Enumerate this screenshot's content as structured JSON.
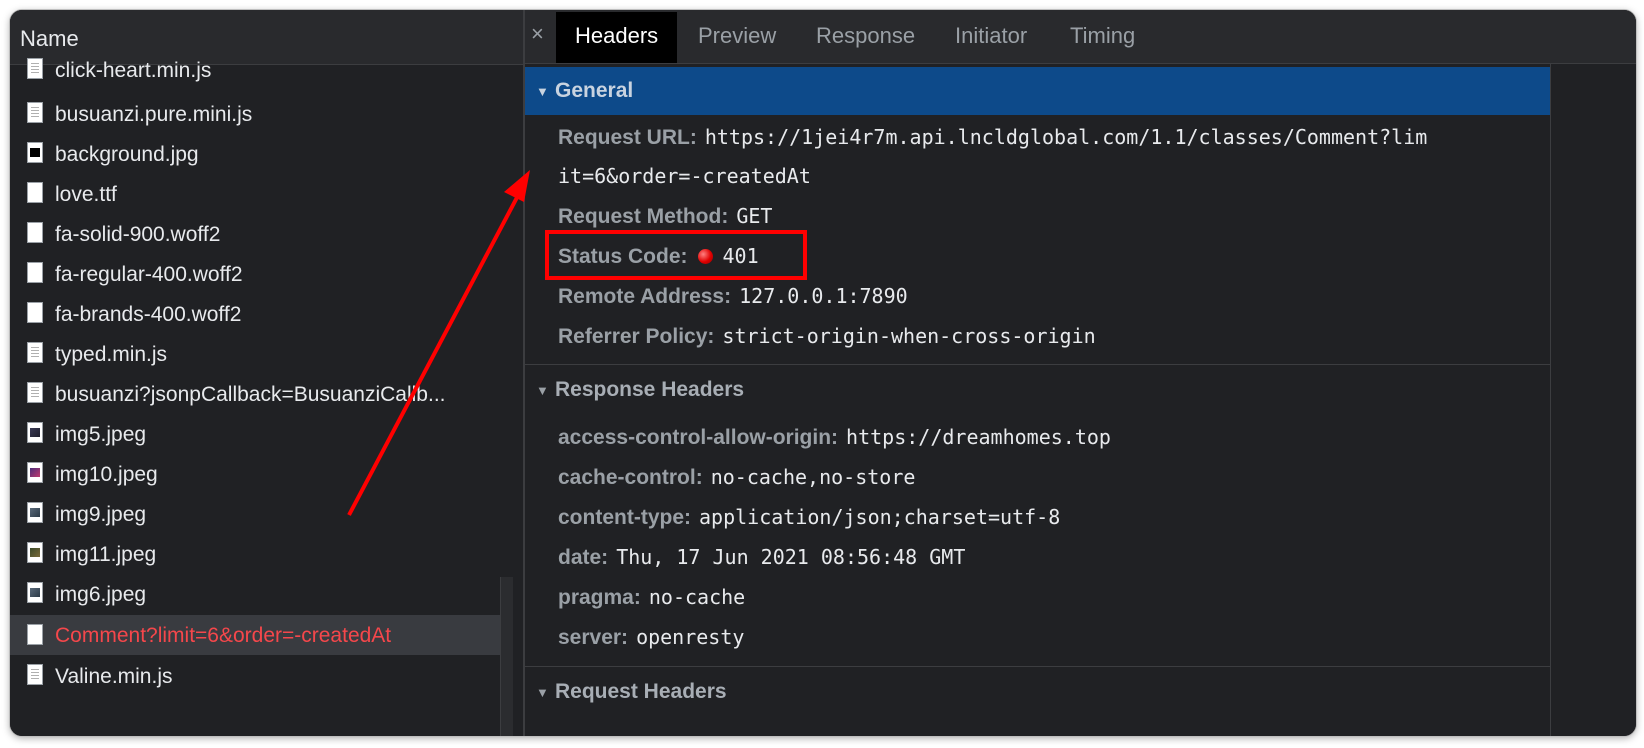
{
  "left": {
    "header": "Name",
    "files": [
      {
        "name": "click-heart.min.js",
        "icon": "js-file-icon"
      },
      {
        "name": "busuanzi.pure.mini.js",
        "icon": "js-file-icon"
      },
      {
        "name": "background.jpg",
        "icon": "image-file-icon"
      },
      {
        "name": "love.ttf",
        "icon": "font-file-icon"
      },
      {
        "name": "fa-solid-900.woff2",
        "icon": "font-file-icon"
      },
      {
        "name": "fa-regular-400.woff2",
        "icon": "font-file-icon"
      },
      {
        "name": "fa-brands-400.woff2",
        "icon": "font-file-icon"
      },
      {
        "name": "typed.min.js",
        "icon": "js-file-icon"
      },
      {
        "name": "busuanzi?jsonpCallback=BusuanziCallb...",
        "icon": "js-file-icon"
      },
      {
        "name": "img5.jpeg",
        "icon": "image-file-icon"
      },
      {
        "name": "img10.jpeg",
        "icon": "image-file-icon"
      },
      {
        "name": "img9.jpeg",
        "icon": "image-file-icon"
      },
      {
        "name": "img11.jpeg",
        "icon": "image-file-icon"
      },
      {
        "name": "img6.jpeg",
        "icon": "image-file-icon"
      },
      {
        "name": "Comment?limit=6&order=-createdAt",
        "icon": "fetch-file-icon",
        "selected": true
      },
      {
        "name": "Valine.min.js",
        "icon": "js-file-icon"
      }
    ]
  },
  "tabs": {
    "close": "×",
    "items": [
      "Headers",
      "Preview",
      "Response",
      "Initiator",
      "Timing"
    ],
    "active": "Headers"
  },
  "general": {
    "title": "General",
    "request_url_key": "Request URL:",
    "request_url_line1": "https://1jei4r7m.api.lncldglobal.com/1.1/classes/Comment?lim",
    "request_url_line2": "it=6&order=-createdAt",
    "method_key": "Request Method:",
    "method_val": "GET",
    "status_key": "Status Code:",
    "status_val": "401",
    "remote_key": "Remote Address:",
    "remote_val": "127.0.0.1:7890",
    "referrer_key": "Referrer Policy:",
    "referrer_val": "strict-origin-when-cross-origin"
  },
  "response_headers": {
    "title": "Response Headers",
    "items": [
      {
        "k": "access-control-allow-origin:",
        "v": "https://dreamhomes.top"
      },
      {
        "k": "cache-control:",
        "v": "no-cache,no-store"
      },
      {
        "k": "content-type:",
        "v": "application/json;charset=utf-8"
      },
      {
        "k": "date:",
        "v": "Thu, 17 Jun 2021 08:56:48 GMT"
      },
      {
        "k": "pragma:",
        "v": "no-cache"
      },
      {
        "k": "server:",
        "v": "openresty"
      }
    ]
  },
  "request_headers": {
    "title": "Request Headers"
  },
  "colors": {
    "panel_bg": "#202124",
    "general_header_bg": "#0d4a8a",
    "selected_text": "#f5474b",
    "annotation": "#ff0000"
  }
}
